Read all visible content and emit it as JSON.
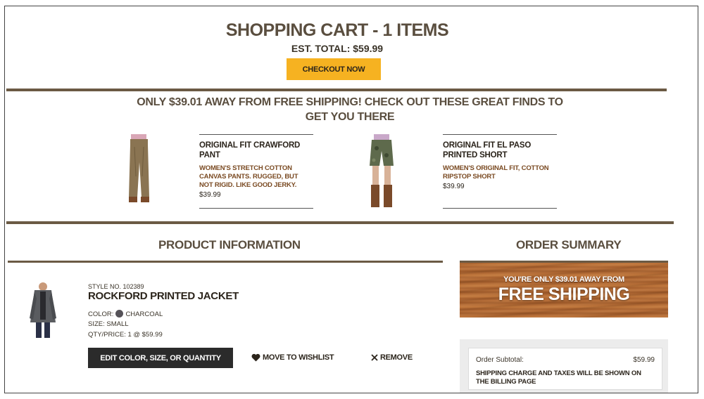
{
  "cart": {
    "title": "SHOPPING CART - 1 ITEMS",
    "est_total": "EST. TOTAL: $59.99",
    "checkout_label": "CHECKOUT NOW"
  },
  "promo": {
    "text": "ONLY $39.01 AWAY FROM FREE SHIPPING! CHECK OUT THESE GREAT FINDS TO GET YOU THERE",
    "items": [
      {
        "name": "ORIGINAL FIT CRAWFORD PANT",
        "description": "WOMEN'S STRETCH COTTON CANVAS PANTS. RUGGED, BUT NOT RIGID. LIKE GOOD JERKY.",
        "price": "$39.99"
      },
      {
        "name": "ORIGINAL FIT EL PASO PRINTED SHORT",
        "description": "WOMEN'S ORIGINAL FIT, COTTON RIPSTOP SHORT",
        "price": "$39.99"
      }
    ]
  },
  "product_section": {
    "heading": "PRODUCT INFORMATION",
    "item": {
      "style_no": "STYLE NO. 102389",
      "name": "ROCKFORD PRINTED JACKET",
      "color_label": "COLOR:",
      "color_value": "CHARCOAL",
      "size": "SIZE: SMALL",
      "qty_price": "QTY/PRICE: 1 @ $59.99",
      "edit_label": "EDIT COLOR, SIZE, OR QUANTITY",
      "wishlist_label": "MOVE TO WISHLIST",
      "remove_label": "REMOVE"
    }
  },
  "order_summary": {
    "heading": "ORDER SUMMARY",
    "banner_line1": "YOU'RE ONLY $39.01 AWAY FROM",
    "banner_line2": "FREE SHIPPING",
    "subtotal_label": "Order Subtotal:",
    "subtotal_value": "$59.99",
    "shipping_note": "SHIPPING CHARGE AND TAXES WILL BE SHOWN ON THE BILLING PAGE"
  },
  "colors": {
    "accent": "#f6b221",
    "heading": "#5a4e3f",
    "rule": "#6b5a44",
    "promo_desc": "#7a4a22"
  }
}
